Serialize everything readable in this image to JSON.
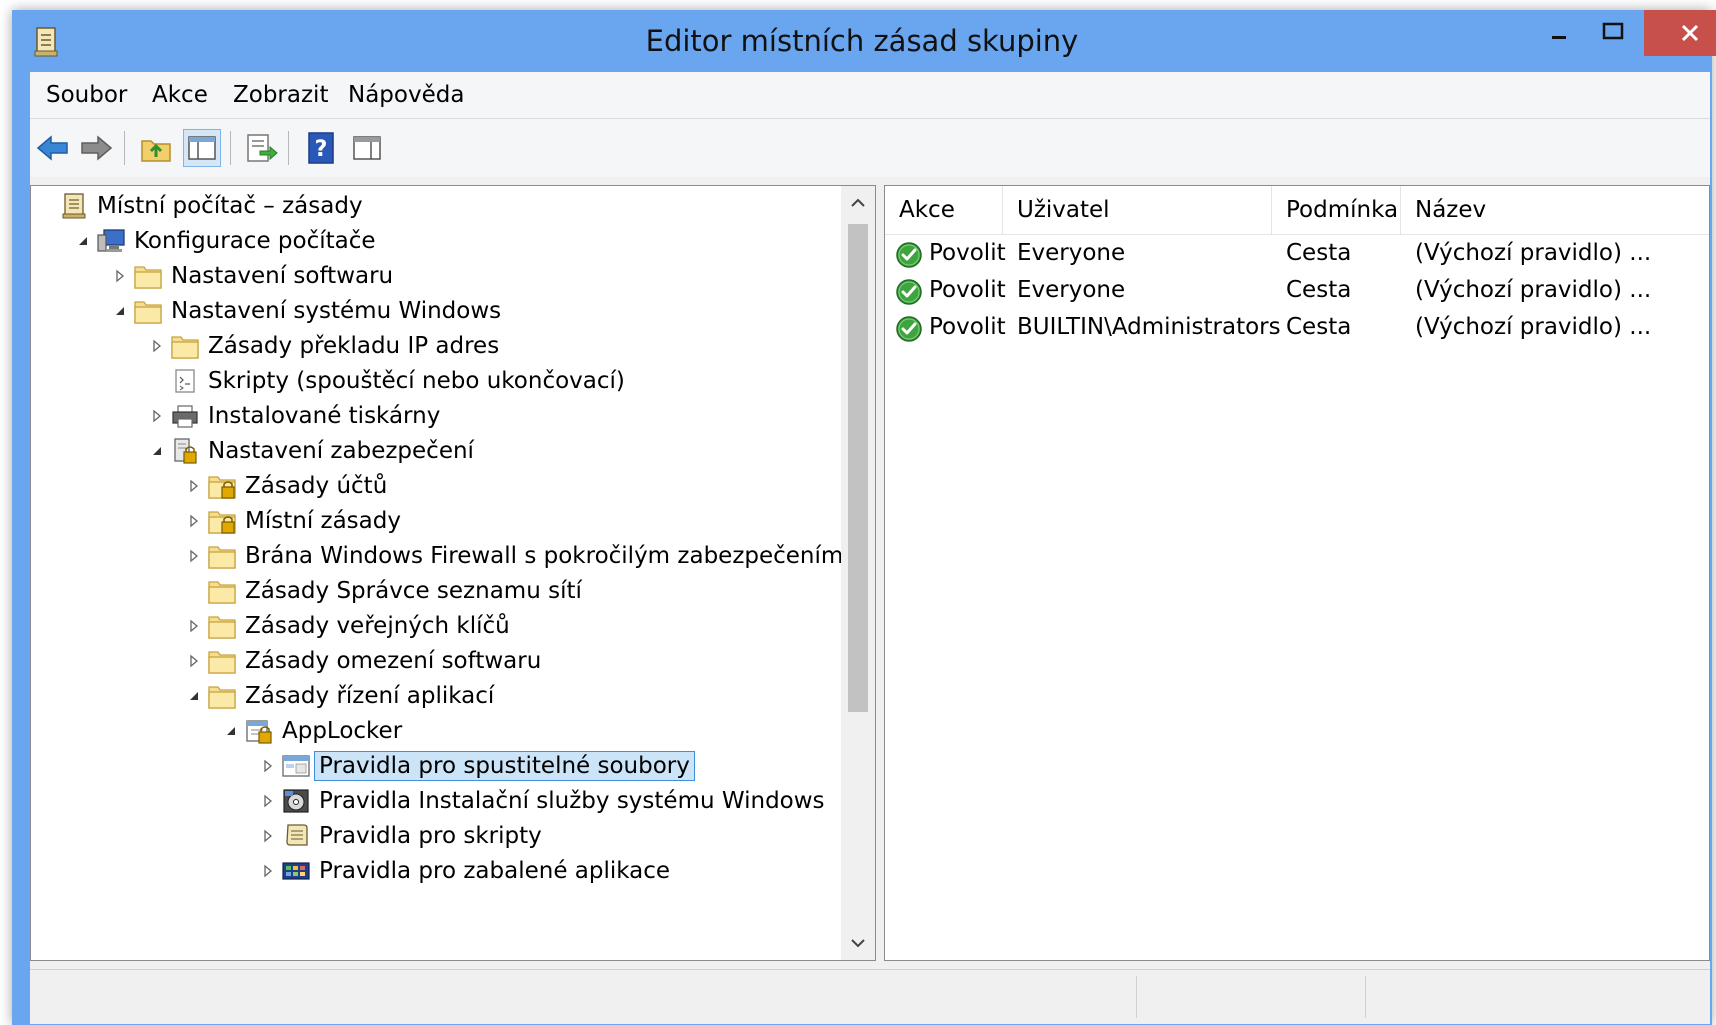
{
  "window": {
    "title": "Editor místních zásad skupiny",
    "controls": {
      "minimize": "minimize-icon",
      "maximize": "maximize-icon",
      "close": "close-icon"
    }
  },
  "menu": {
    "items": [
      "Soubor",
      "Akce",
      "Zobrazit",
      "Nápověda"
    ]
  },
  "toolbar": {
    "buttons": [
      "back-arrow-icon",
      "forward-arrow-icon",
      "up-folder-icon",
      "show-hide-console-tree-icon",
      "export-list-icon",
      "help-icon",
      "show-hide-action-pane-icon"
    ]
  },
  "tree": {
    "nodes": [
      {
        "label": "Místní počítač – zásady",
        "icon": "policy-document-icon",
        "expander": "none"
      },
      {
        "label": "Konfigurace počítače",
        "icon": "computer-icon",
        "expander": "expanded"
      },
      {
        "label": "Nastavení softwaru",
        "icon": "folder-icon",
        "expander": "collapsed"
      },
      {
        "label": "Nastavení systému Windows",
        "icon": "folder-icon",
        "expander": "expanded"
      },
      {
        "label": "Zásady překladu IP adres",
        "icon": "folder-icon",
        "expander": "collapsed"
      },
      {
        "label": "Skripty (spouštěcí nebo ukončovací)",
        "icon": "script-icon",
        "expander": "none"
      },
      {
        "label": "Instalované tiskárny",
        "icon": "printer-icon",
        "expander": "collapsed"
      },
      {
        "label": "Nastavení zabezpečení",
        "icon": "security-settings-icon",
        "expander": "expanded"
      },
      {
        "label": "Zásady účtů",
        "icon": "locked-folder-icon",
        "expander": "collapsed"
      },
      {
        "label": "Místní zásady",
        "icon": "locked-folder-icon",
        "expander": "collapsed"
      },
      {
        "label": "Brána Windows Firewall s pokročilým zabezpečením",
        "icon": "folder-icon",
        "expander": "collapsed"
      },
      {
        "label": "Zásady Správce seznamu sítí",
        "icon": "folder-icon",
        "expander": "none"
      },
      {
        "label": "Zásady veřejných klíčů",
        "icon": "folder-icon",
        "expander": "collapsed"
      },
      {
        "label": "Zásady omezení softwaru",
        "icon": "folder-icon",
        "expander": "collapsed"
      },
      {
        "label": "Zásady řízení aplikací",
        "icon": "folder-icon",
        "expander": "expanded"
      },
      {
        "label": "AppLocker",
        "icon": "applocker-icon",
        "expander": "expanded"
      },
      {
        "label": "Pravidla pro spustitelné soubory",
        "icon": "executable-rules-icon",
        "expander": "collapsed",
        "selected": true
      },
      {
        "label": "Pravidla Instalační služby systému Windows",
        "icon": "installer-rules-icon",
        "expander": "collapsed"
      },
      {
        "label": "Pravidla pro skripty",
        "icon": "script-rules-icon",
        "expander": "collapsed"
      },
      {
        "label": "Pravidla pro zabalené aplikace",
        "icon": "packaged-app-rules-icon",
        "expander": "collapsed"
      }
    ]
  },
  "list": {
    "columns": [
      "Akce",
      "Uživatel",
      "Podmínka",
      "Název"
    ],
    "rows": [
      {
        "action": "Povolit",
        "user": "Everyone",
        "condition": "Cesta",
        "name": "(Výchozí pravidlo) ..."
      },
      {
        "action": "Povolit",
        "user": "Everyone",
        "condition": "Cesta",
        "name": "(Výchozí pravidlo) ..."
      },
      {
        "action": "Povolit",
        "user": "BUILTIN\\Administrators",
        "condition": "Cesta",
        "name": "(Výchozí pravidlo) ..."
      }
    ]
  }
}
